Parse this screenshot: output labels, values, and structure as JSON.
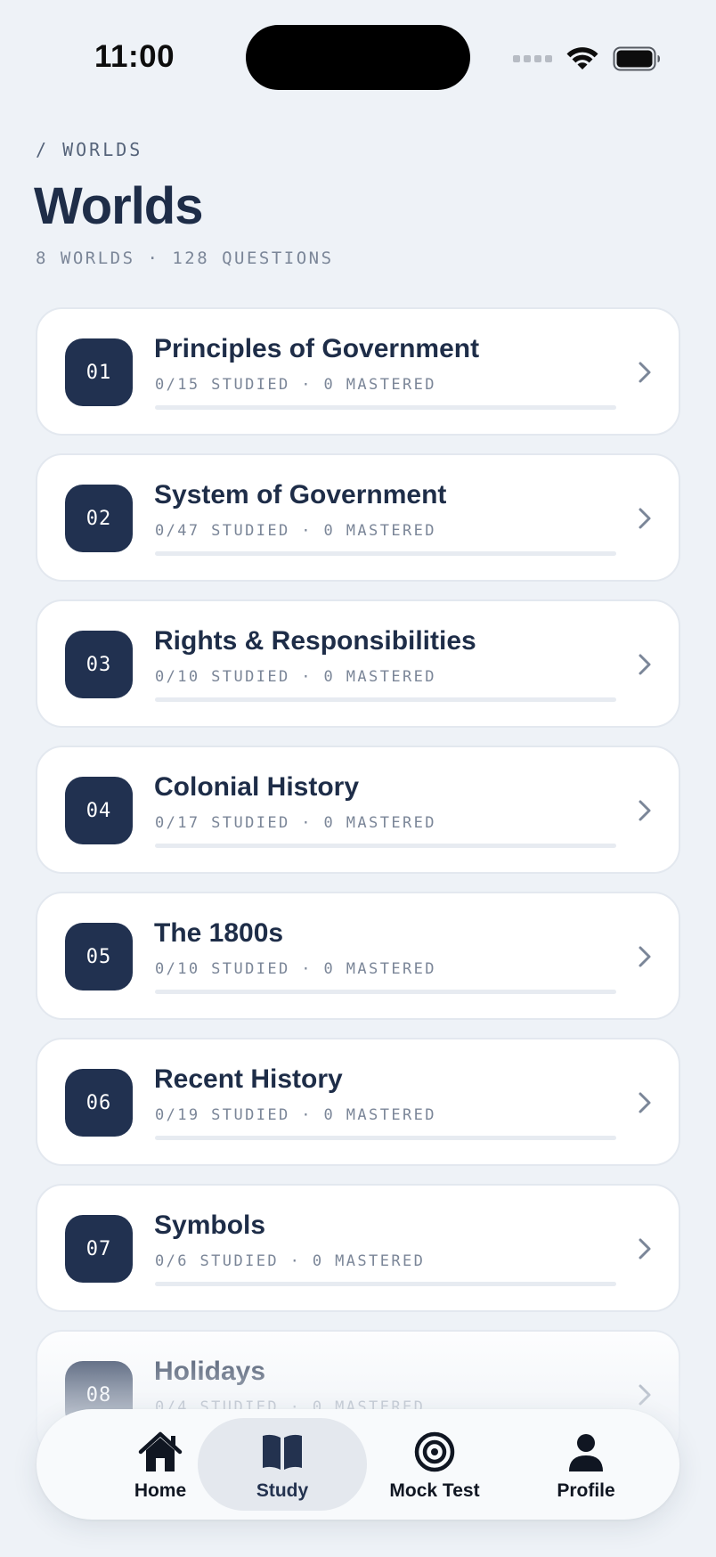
{
  "status_bar": {
    "time": "11:00"
  },
  "header": {
    "breadcrumb": "/ WORLDS",
    "title": "Worlds",
    "subtitle": "8 WORLDS · 128 QUESTIONS"
  },
  "worlds": [
    {
      "number": "01",
      "name": "Principles of Government",
      "stats": "0/15 STUDIED · 0 MASTERED",
      "progress": 0
    },
    {
      "number": "02",
      "name": "System of Government",
      "stats": "0/47 STUDIED · 0 MASTERED",
      "progress": 0
    },
    {
      "number": "03",
      "name": "Rights & Responsibilities",
      "stats": "0/10 STUDIED · 0 MASTERED",
      "progress": 0
    },
    {
      "number": "04",
      "name": "Colonial History",
      "stats": "0/17 STUDIED · 0 MASTERED",
      "progress": 0
    },
    {
      "number": "05",
      "name": "The 1800s",
      "stats": "0/10 STUDIED · 0 MASTERED",
      "progress": 0
    },
    {
      "number": "06",
      "name": "Recent History",
      "stats": "0/19 STUDIED · 0 MASTERED",
      "progress": 0
    },
    {
      "number": "07",
      "name": "Symbols",
      "stats": "0/6 STUDIED · 0 MASTERED",
      "progress": 0
    },
    {
      "number": "08",
      "name": "Holidays",
      "stats": "0/4 STUDIED · 0 MASTERED",
      "progress": 0
    }
  ],
  "tab_bar": {
    "tabs": [
      {
        "label": "Home",
        "icon": "house-icon",
        "active": false
      },
      {
        "label": "Study",
        "icon": "book-icon",
        "active": true
      },
      {
        "label": "Mock Test",
        "icon": "target-icon",
        "active": false
      },
      {
        "label": "Profile",
        "icon": "person-icon",
        "active": false
      }
    ]
  },
  "colors": {
    "background": "#eef2f7",
    "primary": "#213150",
    "text_muted": "#7b8698",
    "card": "#ffffff"
  }
}
